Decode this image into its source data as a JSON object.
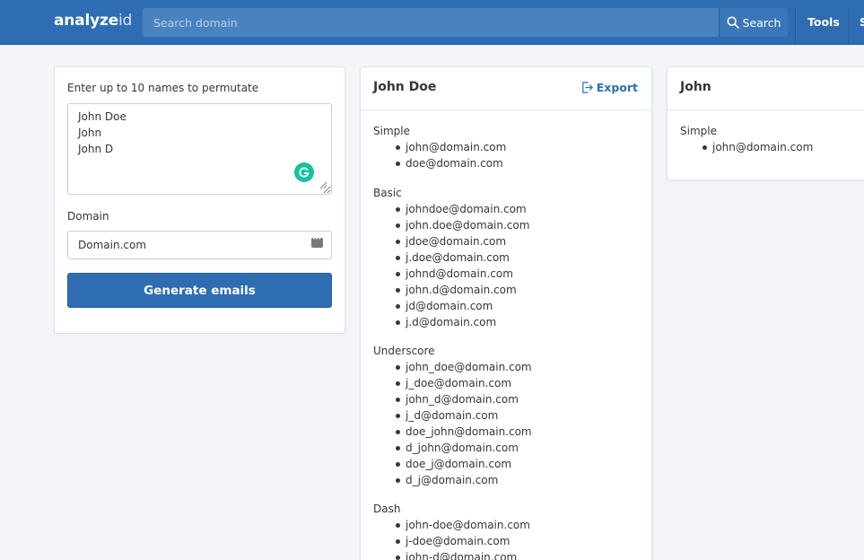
{
  "header": {
    "logo_bold": "analyze",
    "logo_thin": "id",
    "search_placeholder": "Search domain",
    "search_button": "Search",
    "nav": [
      "Tools",
      "S"
    ]
  },
  "form": {
    "names_label": "Enter up to 10 names to permutate",
    "names_value": "John Doe\nJohn\nJohn D",
    "domain_label": "Domain",
    "domain_value": "Domain.com",
    "submit_label": "Generate emails"
  },
  "results": [
    {
      "title": "John Doe",
      "export_label": "Export",
      "groups": [
        {
          "title": "Simple",
          "emails": [
            "john@domain.com",
            "doe@domain.com"
          ]
        },
        {
          "title": "Basic",
          "emails": [
            "johndoe@domain.com",
            "john.doe@domain.com",
            "jdoe@domain.com",
            "j.doe@domain.com",
            "johnd@domain.com",
            "john.d@domain.com",
            "jd@domain.com",
            "j.d@domain.com"
          ]
        },
        {
          "title": "Underscore",
          "emails": [
            "john_doe@domain.com",
            "j_doe@domain.com",
            "john_d@domain.com",
            "j_d@domain.com",
            "doe_john@domain.com",
            "d_john@domain.com",
            "doe_j@domain.com",
            "d_j@domain.com"
          ]
        },
        {
          "title": "Dash",
          "emails": [
            "john-doe@domain.com",
            "j-doe@domain.com",
            "john-d@domain.com"
          ]
        }
      ]
    },
    {
      "title": "John",
      "groups": [
        {
          "title": "Simple",
          "emails": [
            "john@domain.com"
          ]
        }
      ]
    }
  ],
  "colors": {
    "brand": "#2f6db3",
    "grammarly": "#15c39a",
    "page_bg": "#f3f5f8"
  }
}
